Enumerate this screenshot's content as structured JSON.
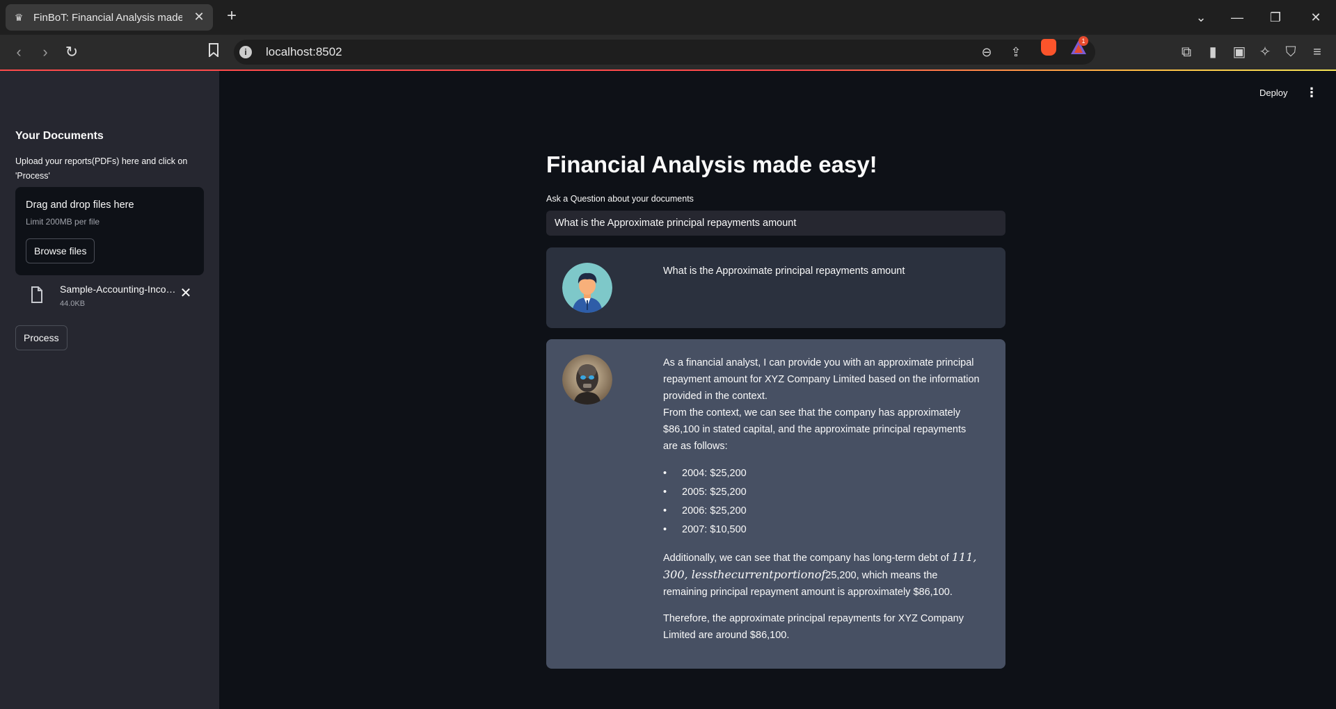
{
  "browser": {
    "tab_title": "FinBoT: Financial Analysis made easy",
    "url": "localhost:8502",
    "rewards_badge": "1"
  },
  "app": {
    "deploy_label": "Deploy"
  },
  "sidebar": {
    "title": "Your Documents",
    "description": "Upload your reports(PDFs) here and click on 'Process'",
    "dropzone_title": "Drag and drop files here",
    "dropzone_limit": "Limit 200MB per file",
    "browse_label": "Browse files",
    "file": {
      "name": "Sample-Accounting-Income-Statement.pdf",
      "size": "44.0KB"
    },
    "process_label": "Process"
  },
  "main": {
    "title": "Financial Analysis made easy!",
    "question_label": "Ask a Question about your documents",
    "question_value": "What is the Approximate principal repayments amount",
    "user_message": "What is the Approximate principal repayments amount",
    "bot_message": {
      "intro": "As a financial analyst, I can provide you with an approximate principal repayment amount for XYZ Company Limited based on the information provided in the context.",
      "context": "From the context, we can see that the company has approximately $86,100 in stated capital, and the approximate principal repayments are as follows:",
      "repayments": [
        "2004: $25,200",
        "2005: $25,200",
        "2006: $25,200",
        "2007: $10,500"
      ],
      "additional_prefix": "Additionally, we can see that the company has long-term debt of",
      "additional_math": "111, 300, lessthecurrentportionof",
      "additional_suffix": "25,200, which means the remaining principal repayment amount is approximately $86,100.",
      "conclusion": "Therefore, the approximate principal repayments for XYZ Company Limited are around $86,100."
    }
  }
}
